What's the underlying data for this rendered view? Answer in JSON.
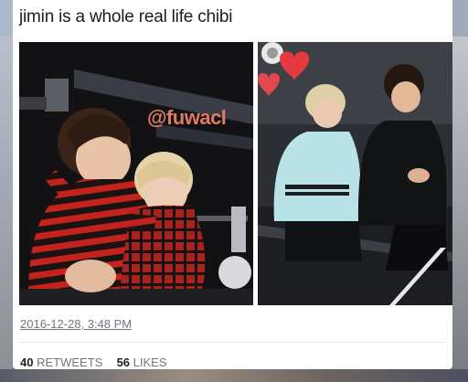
{
  "tweet": {
    "text": "jimin is a whole real life chibi",
    "timestamp": "2016-12-28, 3:48 PM",
    "retweets_count": "40",
    "retweets_label": "RETWEETS",
    "likes_count": "56",
    "likes_label": "LIKES"
  },
  "photos": {
    "left_watermark": "@fuwacl"
  }
}
